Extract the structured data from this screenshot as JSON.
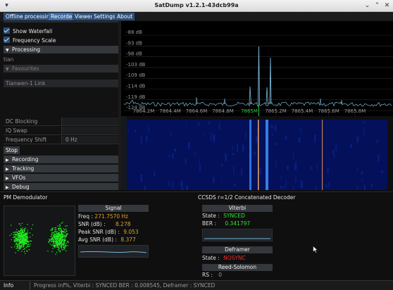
{
  "window": {
    "title": "SatDump v1.2.1-43dcb99a"
  },
  "menu": [
    {
      "label": "Offline processing"
    },
    {
      "label": "Recorder"
    },
    {
      "label": "Viewer"
    },
    {
      "label": "Settings"
    },
    {
      "label": "About"
    }
  ],
  "left_panel": {
    "show_waterfall": "Show Waterfall",
    "frequency_scale": "Frequency Scale",
    "processing": "Processing",
    "tian_text": "tian",
    "favourites": "Favourites",
    "pipeline_name": "Tianwen-1 Link",
    "settings": [
      {
        "label": "DC Blocking",
        "value": ""
      },
      {
        "label": "IQ Swap",
        "value": ""
      },
      {
        "label": "Frequency Shift",
        "value": "0 Hz"
      }
    ],
    "stop": "Stop",
    "sections": [
      "Recording",
      "Tracking",
      "VFOs",
      "Debug"
    ]
  },
  "fft": {
    "db_labels": [
      "-88 dB",
      "-93 dB",
      "-98 dB",
      "-103 dB",
      "-109 dB",
      "-114 dB",
      "-119 dB",
      "-124 dB",
      "-130 dB"
    ],
    "freq_labels": [
      "7864.2M",
      "7864.4M",
      "7864.6M",
      "7864.8M",
      "7865M",
      "7865.2M",
      "7865.4M",
      "7865.6M",
      "7865.8M"
    ],
    "center_label": "7865M",
    "colors": {
      "trace": "#2ad0d0",
      "center": "#22cc44",
      "accent": "#e0a060"
    }
  },
  "demod": {
    "title": "PM Demodulator",
    "signal_title": "Signal",
    "freq_label": "Freq :",
    "freq_value": "271.7570 Hz",
    "snr_label": "SNR (dB) :",
    "snr_value": "8.278",
    "peak_label": "Peak SNR (dB) :",
    "peak_value": "9.053",
    "avg_label": "Avg SNR (dB) :",
    "avg_value": "8.377"
  },
  "decoder": {
    "title": "CCSDS r=1/2 Concatenated Decoder",
    "viterbi_title": "Viterbi",
    "state_label": "State :",
    "viterbi_state": "SYNCED",
    "ber_label": "BER :",
    "ber_value": "0.341797",
    "deframer_title": "Deframer",
    "deframer_state": "NOSYNC",
    "rs_title": "Reed-Solomon",
    "rs_label": "RS :",
    "rs_value": "0"
  },
  "status": {
    "info": "Info",
    "message": "Progress inf%, Viterbi : SYNCED BER : 0.008545, Deframer : SYNCED"
  }
}
